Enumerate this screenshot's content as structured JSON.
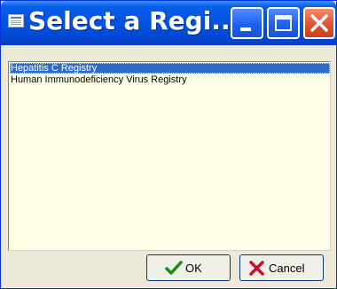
{
  "window": {
    "title": "Select a Regi..."
  },
  "registries": [
    {
      "label": "Hepatitis C Registry",
      "selected": true
    },
    {
      "label": "Human Immunodeficiency Virus Registry",
      "selected": false
    }
  ],
  "buttons": {
    "ok_label": "OK",
    "cancel_label": "Cancel"
  },
  "icons": {
    "title": "app-icon",
    "ok": "checkmark-icon",
    "cancel": "red-x-icon"
  },
  "colors": {
    "titlebar": "#0054e3",
    "close_button": "#e0522e",
    "selection": "#316ac5",
    "list_background": "#ffffe7",
    "ok_check": "#1a8c1a",
    "cancel_x": "#c8102e"
  }
}
